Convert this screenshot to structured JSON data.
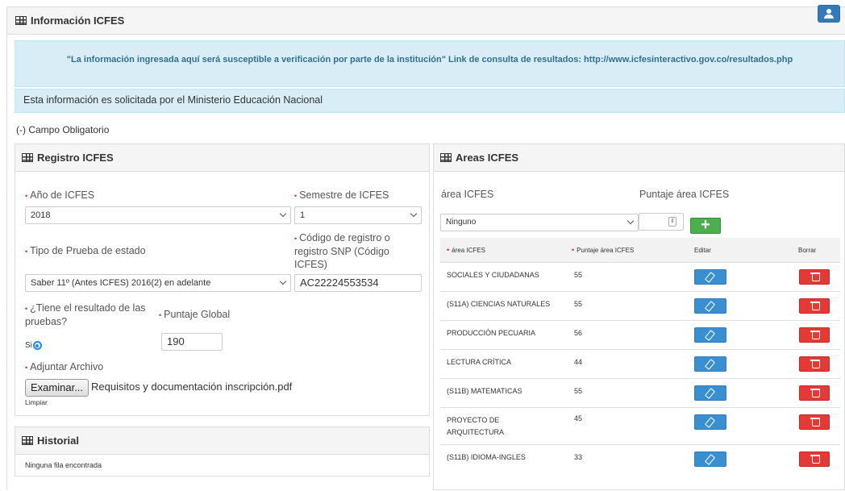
{
  "main": {
    "title": "Información ICFES",
    "notice": "\"La información ingresada aquí será susceptible a verificación por parte de la institución\" Link de consulta de resultados: http://www.icfesinteractivo.gov.co/resultados.php",
    "ministry_note": "Esta información es solicitada por el Ministerio Educación Nacional",
    "required_note": "(-) Campo Obligatorio"
  },
  "registro": {
    "title": "Registro ICFES",
    "year_label": "Año de ICFES",
    "year_value": "2018",
    "semester_label": "Semestre de ICFES",
    "semester_value": "1",
    "test_type_label": "Tipo de Prueba de estado",
    "test_type_value": "Saber 11º (Antes ICFES) 2016(2) en adelante",
    "snp_label": "Código de registro o registro SNP (Código ICFES)",
    "snp_value": "AC22224553534",
    "has_result_label": "¿Tiene el resultado de las pruebas?",
    "has_result_option": "Si",
    "score_label": "Puntaje Global",
    "score_value": "190",
    "attach_label": "Adjuntar Archivo",
    "browse_label": "Examinar...",
    "file_name": "Requisitos y documentación inscripción.pdf",
    "clear_label": "Limpiar"
  },
  "historial": {
    "title": "Historial",
    "empty_text": "Ninguna fila encontrada"
  },
  "areas": {
    "title": "Areas ICFES",
    "area_label": "área ICFES",
    "score_label": "Puntaje área ICFES",
    "area_select_value": "Ninguno",
    "add_label": "+",
    "headers": {
      "area": "área ICFES",
      "score": "Puntaje área ICFES",
      "edit": "Editar",
      "delete": "Borrar"
    },
    "rows": [
      {
        "area": "SOCIALES Y CIUDADANAS",
        "score": "55"
      },
      {
        "area": "(S11A) CIENCIAS NATURALES",
        "score": "55"
      },
      {
        "area": "PRODUCCIÓN PECUARIA",
        "score": "56"
      },
      {
        "area": "LECTURA CRÍTICA",
        "score": "44"
      },
      {
        "area": "(S11B) MATEMATICAS",
        "score": "55"
      },
      {
        "area": "PROYECTO DE ARQUITECTURA",
        "score": "45"
      },
      {
        "area": "(S11B) IDIOMA-INGLES",
        "score": "33"
      }
    ]
  },
  "colors": {
    "primary": "#337ab7",
    "danger": "#e53935",
    "success": "#4cae4c",
    "info_bg": "#d9edf7"
  }
}
